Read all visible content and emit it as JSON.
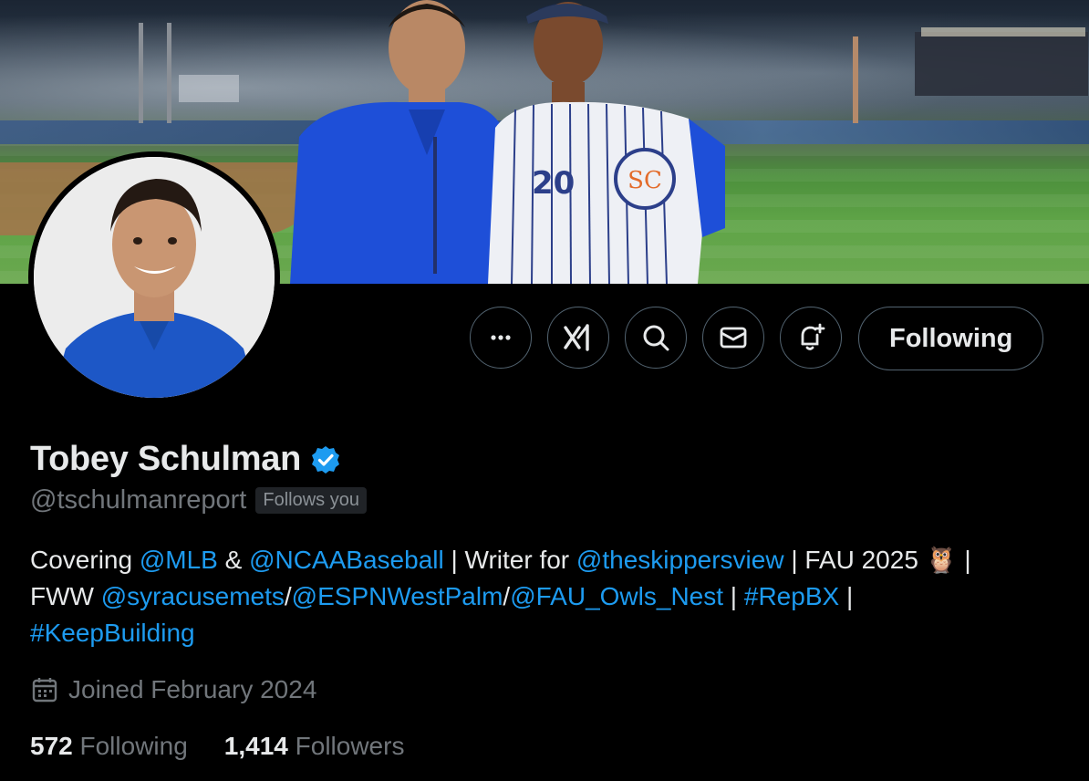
{
  "banner": {
    "photo_icon": "banner-photo",
    "jersey_number": "20",
    "jersey_logo": "SC"
  },
  "avatar": {
    "icon": "avatar-photo"
  },
  "actions": {
    "more_icon": "more-icon",
    "grok_icon": "grok-icon",
    "search_icon": "search-icon",
    "message_icon": "mail-icon",
    "notify_icon": "bell-plus-icon",
    "following_label": "Following"
  },
  "profile": {
    "name": "Tobey Schulman",
    "verified_icon": "verified-badge-icon",
    "verified_color": "#1d9bf0",
    "handle": "@tschulmanreport",
    "follows_you": "Follows you"
  },
  "bio": {
    "parts": [
      "Covering ",
      "@MLB",
      " & ",
      "@NCAABaseball",
      " | Writer for ",
      "@theskippersview",
      " | FAU 2025 ",
      "🦉",
      " |",
      "FWW ",
      "@syracusemets",
      "/",
      "@ESPNWestPalm",
      "/",
      "@FAU_Owls_Nest",
      " | ",
      "#RepBX",
      " |",
      "#KeepBuilding"
    ]
  },
  "joined": {
    "icon": "calendar-icon",
    "text": "Joined February 2024"
  },
  "stats": {
    "following_count": "572",
    "following_label": "Following",
    "followers_count": "1,414",
    "followers_label": "Followers"
  },
  "colors": {
    "link": "#1d9bf0",
    "muted": "#71767b",
    "text": "#e7e9ea",
    "border": "#536471",
    "bg": "#000000"
  }
}
